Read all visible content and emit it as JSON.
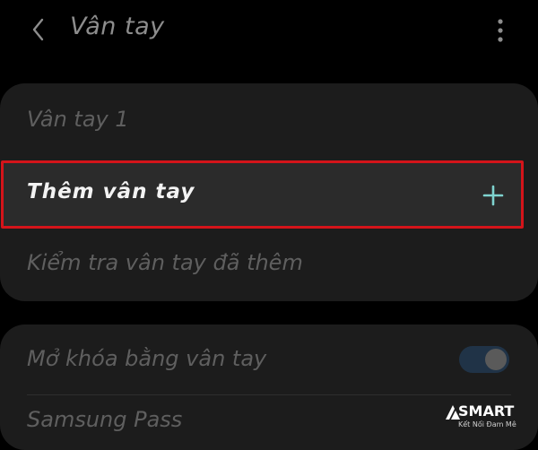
{
  "header": {
    "title": "Vân tay",
    "back_icon": "chevron-left-icon",
    "more_icon": "more-vert-icon"
  },
  "fingerprint_list": {
    "items": [
      {
        "label": "Vân tay 1"
      }
    ],
    "add_fingerprint": {
      "label": "Thêm vân tay",
      "icon": "plus-icon",
      "highlight_color": "#d4141a",
      "icon_color": "#7fd3cf"
    },
    "check_fingerprints": {
      "label": "Kiểm tra vân tay đã thêm"
    }
  },
  "options": {
    "fingerprint_unlock": {
      "label": "Mở khóa bằng vân tay",
      "enabled": true,
      "toggle_track_color": "#203347"
    },
    "samsung_pass": {
      "label": "Samsung Pass"
    }
  },
  "watermark": {
    "brand": "SMART",
    "tagline": "Kết Nối Đam Mê"
  }
}
